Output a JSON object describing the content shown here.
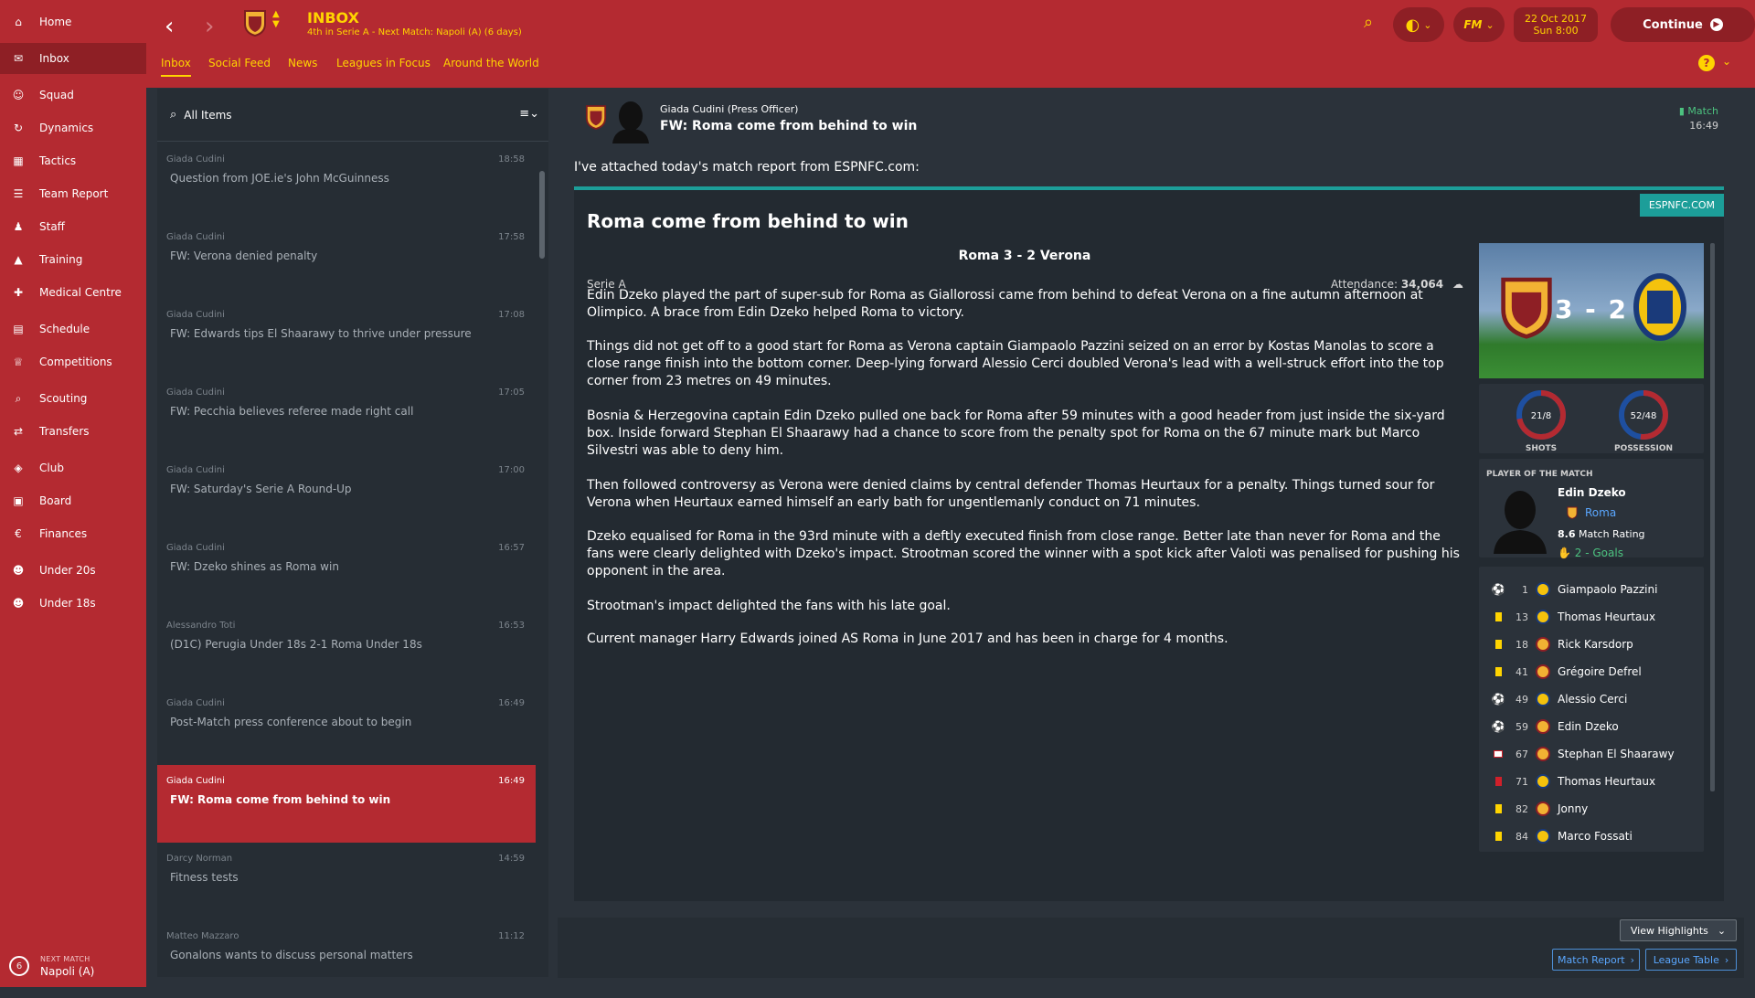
{
  "sidebar": {
    "items": [
      {
        "label": "Home",
        "icon": "home-icon"
      },
      {
        "label": "Inbox",
        "icon": "inbox-icon"
      },
      {
        "label": "Squad",
        "icon": "squad-icon"
      },
      {
        "label": "Dynamics",
        "icon": "dynamics-icon"
      },
      {
        "label": "Tactics",
        "icon": "tactics-icon"
      },
      {
        "label": "Team Report",
        "icon": "team-report-icon"
      },
      {
        "label": "Staff",
        "icon": "staff-icon"
      },
      {
        "label": "Training",
        "icon": "training-icon"
      },
      {
        "label": "Medical Centre",
        "icon": "medical-icon"
      },
      {
        "label": "Schedule",
        "icon": "schedule-icon"
      },
      {
        "label": "Competitions",
        "icon": "trophy-icon"
      },
      {
        "label": "Scouting",
        "icon": "scouting-icon"
      },
      {
        "label": "Transfers",
        "icon": "transfers-icon"
      },
      {
        "label": "Club",
        "icon": "club-icon"
      },
      {
        "label": "Board",
        "icon": "board-icon"
      },
      {
        "label": "Finances",
        "icon": "finances-icon"
      },
      {
        "label": "Under 20s",
        "icon": "under20-icon"
      },
      {
        "label": "Under 18s",
        "icon": "under18-icon"
      }
    ],
    "next_match": {
      "label": "NEXT MATCH",
      "value": "Napoli (A)",
      "days": "6"
    }
  },
  "topbar": {
    "title": "INBOX",
    "subtitle": "4th in Serie A - Next Match: Napoli (A) (6 days)",
    "tabs": [
      "Inbox",
      "Social Feed",
      "News",
      "Leagues in Focus",
      "Around the World"
    ],
    "date": "22 Oct 2017",
    "time": "Sun 8:00",
    "continue_label": "Continue"
  },
  "list": {
    "filter_label": "All Items",
    "messages": [
      {
        "sender": "Giada Cudini",
        "time": "18:58",
        "subject": "Question from JOE.ie's John McGuinness"
      },
      {
        "sender": "Giada Cudini",
        "time": "17:58",
        "subject": "FW: Verona denied penalty"
      },
      {
        "sender": "Giada Cudini",
        "time": "17:08",
        "subject": "FW: Edwards tips El Shaarawy to thrive under pressure"
      },
      {
        "sender": "Giada Cudini",
        "time": "17:05",
        "subject": "FW: Pecchia believes referee made right call"
      },
      {
        "sender": "Giada Cudini",
        "time": "17:00",
        "subject": "FW: Saturday's Serie A Round-Up"
      },
      {
        "sender": "Giada Cudini",
        "time": "16:57",
        "subject": "FW: Dzeko shines as Roma win"
      },
      {
        "sender": "Alessandro Toti",
        "time": "16:53",
        "subject": "(D1C) Perugia Under 18s 2-1 Roma Under 18s"
      },
      {
        "sender": "Giada Cudini",
        "time": "16:49",
        "subject": "Post-Match press conference about to begin"
      },
      {
        "sender": "Giada Cudini",
        "time": "16:49",
        "subject": "FW: Roma come from behind to win"
      },
      {
        "sender": "Darcy Norman",
        "time": "14:59",
        "subject": "Fitness tests"
      },
      {
        "sender": "Matteo Mazzaro",
        "time": "11:12",
        "subject": "Gonalons wants to discuss personal matters"
      }
    ]
  },
  "message": {
    "sender": "Giada Cudini",
    "sender_role": "(Press Officer)",
    "subject": "FW: Roma come from behind to win",
    "tag": "Match",
    "time": "16:49",
    "intro": "I've attached today's match report from ESPNFC.com:",
    "source": "ESPNFC.COM",
    "article_title": "Roma come from behind to win",
    "score_line": "Roma 3 - 2  Verona",
    "competition": "Serie A",
    "attendance_label": "Attendance:",
    "attendance": "34,064",
    "paragraphs": [
      "Edin Dzeko played the part of super-sub for Roma as Giallorossi came from behind to defeat Verona on a fine autumn afternoon at Olimpico. A brace from Edin Dzeko helped Roma to victory.",
      "Things did not get off to a good start for Roma as Verona captain Giampaolo Pazzini seized on an error by Kostas Manolas to score a close range finish into the bottom corner. Deep-lying forward Alessio Cerci doubled Verona's lead with a well-struck effort into the top corner from 23 metres on 49 minutes.",
      "Bosnia & Herzegovina captain Edin Dzeko pulled one back for Roma after 59 minutes with a good header from just inside the six-yard box. Inside forward Stephan El Shaarawy had a chance to score from the penalty spot for Roma on the 67 minute mark but Marco Silvestri was able to deny him.",
      "Then followed controversy as Verona were denied claims by central defender Thomas Heurtaux for a penalty. Things turned sour for Verona when Heurtaux earned himself an early bath for ungentlemanly conduct on 71 minutes.",
      "Dzeko equalised for Roma in the 93rd minute with a deftly executed finish from close range. Better late than never for Roma and the fans were clearly delighted with Dzeko's impact. Strootman scored the winner with a spot kick after Valoti was penalised for pushing his opponent in the area.",
      "Strootman's impact delighted the fans with his late goal.",
      "Current manager Harry Edwards joined AS Roma in June 2017 and has been in charge for 4 months."
    ],
    "scoreboard": "3 - 2",
    "stats": [
      {
        "value": "21/8",
        "label": "SHOTS",
        "home_share": 0.72
      },
      {
        "value": "52/48",
        "label": "POSSESSION",
        "home_share": 0.52
      }
    ],
    "potm": {
      "label": "PLAYER OF THE MATCH",
      "name": "Edin Dzeko",
      "club": "Roma",
      "rating": "8.6",
      "rating_label": "Match Rating",
      "goals": "2 - Goals"
    },
    "events": [
      {
        "type": "goal",
        "minute": "1",
        "player": "Giampaolo Pazzini",
        "team": "verona"
      },
      {
        "type": "yellow",
        "minute": "13",
        "player": "Thomas Heurtaux",
        "team": "verona"
      },
      {
        "type": "yellow",
        "minute": "18",
        "player": "Rick Karsdorp",
        "team": "roma"
      },
      {
        "type": "yellow",
        "minute": "41",
        "player": "Grégoire Defrel",
        "team": "roma"
      },
      {
        "type": "goal",
        "minute": "49",
        "player": "Alessio Cerci",
        "team": "verona"
      },
      {
        "type": "goal",
        "minute": "59",
        "player": "Edin Dzeko",
        "team": "roma"
      },
      {
        "type": "missed-pen",
        "minute": "67",
        "player": "Stephan El Shaarawy",
        "team": "roma"
      },
      {
        "type": "red",
        "minute": "71",
        "player": "Thomas Heurtaux",
        "team": "verona"
      },
      {
        "type": "yellow",
        "minute": "82",
        "player": "Jonny",
        "team": "roma"
      },
      {
        "type": "yellow",
        "minute": "84",
        "player": "Marco Fossati",
        "team": "verona"
      }
    ]
  },
  "footer": {
    "view_highlights": "View Highlights",
    "match_report": "Match Report",
    "league_table": "League Table"
  },
  "colors": {
    "accent": "#b42a31",
    "gold": "#ffd400",
    "teal": "#1c9e99",
    "link": "#5aa7ff"
  }
}
